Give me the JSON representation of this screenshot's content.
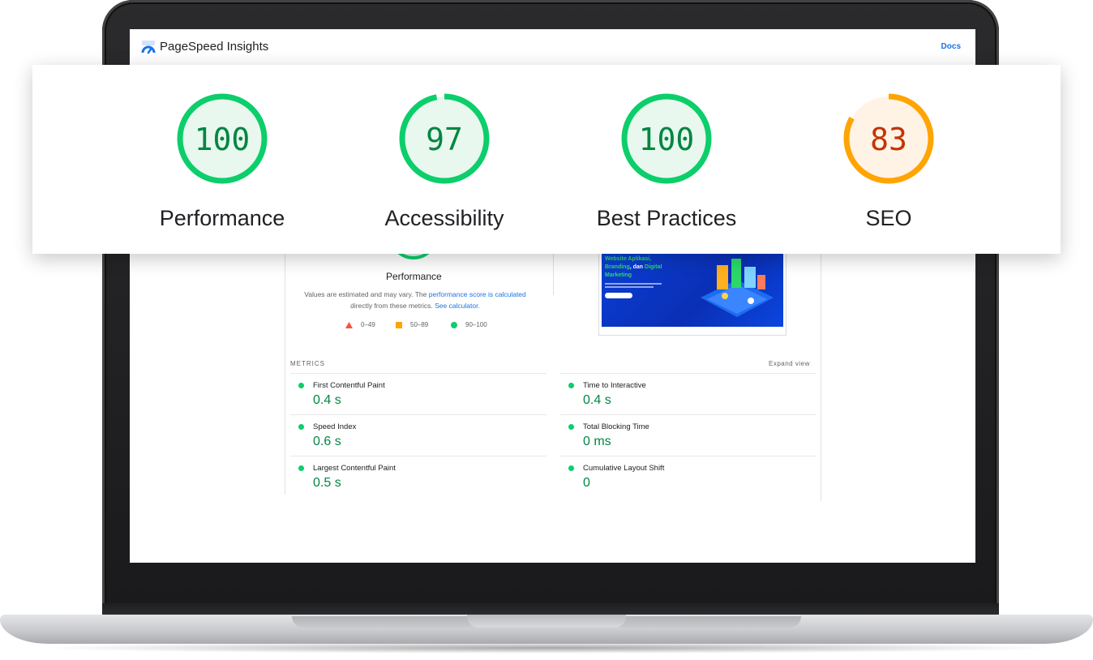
{
  "app": {
    "title": "PageSpeed Insights",
    "docs_label": "Docs"
  },
  "colors": {
    "pass": "#0cce6b",
    "pass_text": "#018642",
    "average": "#ffa400",
    "average_text": "#c33300",
    "fail": "#ff4e42",
    "link": "#1a73e8"
  },
  "scores": [
    {
      "label": "Performance",
      "value": "100",
      "score": 100,
      "status": "pass"
    },
    {
      "label": "Accessibility",
      "value": "97",
      "score": 97,
      "status": "pass"
    },
    {
      "label": "Best Practices",
      "value": "100",
      "score": 100,
      "status": "pass"
    },
    {
      "label": "SEO",
      "value": "83",
      "score": 83,
      "status": "average"
    }
  ],
  "performance_section": {
    "label": "Performance",
    "desc_prefix": "Values are estimated and may vary. The ",
    "desc_link1": "performance score is calculated",
    "desc_mid": " directly from these metrics. ",
    "desc_link2": "See calculator.",
    "legend": [
      {
        "range": "0–49",
        "icon": "triangle-icon"
      },
      {
        "range": "50–89",
        "icon": "square-icon"
      },
      {
        "range": "90–100",
        "icon": "circle-icon"
      }
    ]
  },
  "screenshot": {
    "line1": "Website Aplikasi,",
    "line2a": "Branding",
    "line2b": ", dan ",
    "line2c": "Digital",
    "line3": "Marketing"
  },
  "metrics": {
    "title": "METRICS",
    "expand_label": "Expand view",
    "left": [
      {
        "name": "First Contentful Paint",
        "value": "0.4 s"
      },
      {
        "name": "Speed Index",
        "value": "0.6 s"
      },
      {
        "name": "Largest Contentful Paint",
        "value": "0.5 s"
      }
    ],
    "right": [
      {
        "name": "Time to Interactive",
        "value": "0.4 s"
      },
      {
        "name": "Total Blocking Time",
        "value": "0 ms"
      },
      {
        "name": "Cumulative Layout Shift",
        "value": "0"
      }
    ]
  }
}
